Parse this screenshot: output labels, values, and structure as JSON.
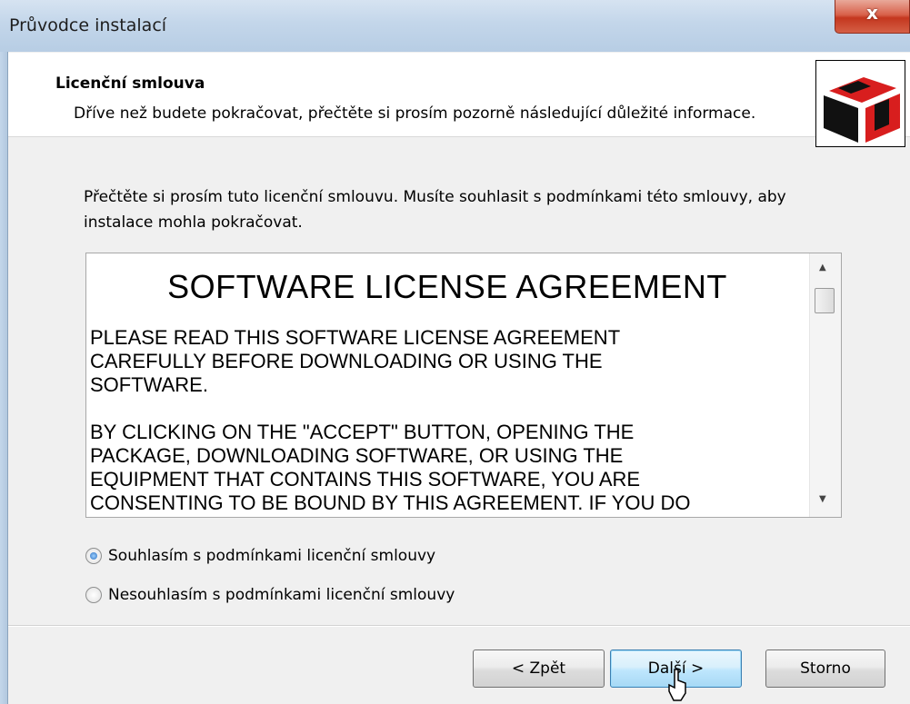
{
  "window": {
    "title": "Průvodce instalací",
    "close_label": "x"
  },
  "header": {
    "title": "Licenční smlouva",
    "subtitle": "Dříve než budete pokračovat, přečtěte si prosím pozorně následující důležité informace."
  },
  "intro": "Přečtěte si prosím tuto licenční smlouvu. Musíte souhlasit s podmínkami této smlouvy, aby instalace mohla pokračovat.",
  "license": {
    "title": "SOFTWARE LICENSE AGREEMENT",
    "body": "PLEASE READ THIS SOFTWARE LICENSE AGREEMENT\nCAREFULLY BEFORE DOWNLOADING OR USING THE\nSOFTWARE.\n\nBY CLICKING ON THE \"ACCEPT\" BUTTON, OPENING THE\nPACKAGE, DOWNLOADING SOFTWARE, OR USING THE\nEQUIPMENT THAT CONTAINS THIS SOFTWARE, YOU ARE\nCONSENTING TO BE BOUND BY THIS AGREEMENT. IF YOU DO"
  },
  "options": {
    "accept_label": "Souhlasím s podmínkami licenční smlouvy",
    "decline_label": "Nesouhlasím s podmínkami licenční smlouvy",
    "selected": "accept"
  },
  "buttons": {
    "back": "< Zpět",
    "next": "Další >",
    "cancel": "Storno"
  },
  "colors": {
    "logo_red": "#d81e1e",
    "logo_black": "#111111",
    "default_button_border": "#3c7fb1"
  }
}
